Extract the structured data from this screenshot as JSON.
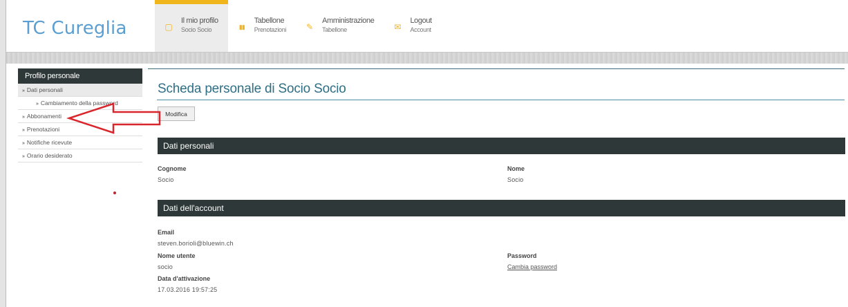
{
  "brand": "TC Cureglia",
  "nav": [
    {
      "title": "Il mio profilo",
      "sub": "Socio Socio",
      "icon": "profile-icon",
      "glyph": "▢",
      "active": true
    },
    {
      "title": "Tabellone",
      "sub": "Prenotazioni",
      "icon": "grid-icon",
      "glyph": "▮▮",
      "active": false
    },
    {
      "title": "Amministrazione",
      "sub": "Tabellone",
      "icon": "edit-icon",
      "glyph": "✎",
      "active": false
    },
    {
      "title": "Logout",
      "sub": "Account",
      "icon": "mail-icon",
      "glyph": "✉",
      "active": false
    }
  ],
  "sidebar": {
    "heading": "Profilo personale",
    "items": [
      {
        "label": "Dati personali"
      },
      {
        "label": "Cambiamento della password"
      },
      {
        "label": "Abbonamenti"
      },
      {
        "label": "Prenotazioni"
      },
      {
        "label": "Notifiche ricevute"
      },
      {
        "label": "Orario desiderato"
      }
    ]
  },
  "main": {
    "title": "Scheda personale di Socio Socio",
    "modifica_label": "Modifica",
    "section_personal": "Dati personali",
    "section_account": "Dati dell'account",
    "cognome_label": "Cognome",
    "cognome_value": "Socio",
    "nome_label": "Nome",
    "nome_value": "Socio",
    "email_label": "Email",
    "email_value": "steven.borioli@bluewin.ch",
    "username_label": "Nome utente",
    "username_value": "socio",
    "password_label": "Password",
    "password_link": "Cambia password",
    "activation_label": "Data d'attivazione",
    "activation_value": "17.03.2016 19:57:25"
  },
  "colors": {
    "accent": "#f1b51c",
    "brand": "#5b9fd2",
    "dark_bar": "#2f3838",
    "title": "#2f6f86",
    "annotation_arrow": "#d9262c"
  }
}
